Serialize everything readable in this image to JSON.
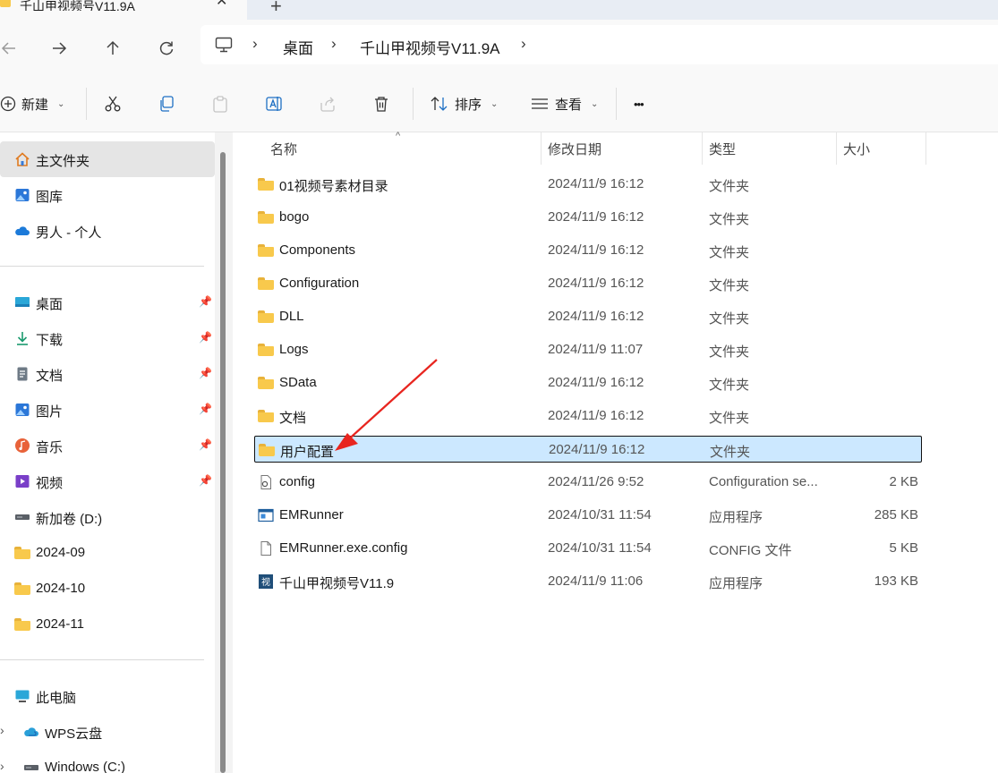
{
  "window": {
    "tab_title": "千山甲视频号V11.9A",
    "tab_close": "✕",
    "new_tab": "+"
  },
  "breadcrumb": {
    "items": [
      "桌面",
      "千山甲视频号V11.9A"
    ],
    "separator": "›"
  },
  "toolbar": {
    "new_label": "新建",
    "sort_label": "排序",
    "view_label": "查看",
    "more_label": "•••"
  },
  "sidebar": {
    "top": [
      {
        "label": "主文件夹",
        "icon": "home-icon"
      },
      {
        "label": "图库",
        "icon": "gallery-icon"
      },
      {
        "label": "男人 - 个人",
        "icon": "onedrive-cloud-icon"
      }
    ],
    "quick": [
      {
        "label": "桌面",
        "icon": "desktop-icon"
      },
      {
        "label": "下载",
        "icon": "download-icon"
      },
      {
        "label": "文档",
        "icon": "document-icon"
      },
      {
        "label": "图片",
        "icon": "pictures-icon"
      },
      {
        "label": "音乐",
        "icon": "music-icon"
      },
      {
        "label": "视频",
        "icon": "video-icon"
      },
      {
        "label": "新加卷 (D:)",
        "icon": "drive-icon"
      },
      {
        "label": "2024-09",
        "icon": "folder-icon"
      },
      {
        "label": "2024-10",
        "icon": "folder-icon"
      },
      {
        "label": "2024-11",
        "icon": "folder-icon"
      }
    ],
    "bottom": [
      {
        "label": "此电脑",
        "icon": "this-pc-icon"
      },
      {
        "label": "WPS云盘",
        "icon": "wps-cloud-icon"
      },
      {
        "label": "Windows (C:)",
        "icon": "drive-icon"
      }
    ]
  },
  "columns": {
    "name": "名称",
    "date": "修改日期",
    "type": "类型",
    "size": "大小"
  },
  "files": [
    {
      "name": "01视频号素材目录",
      "date": "2024/11/9 16:12",
      "type": "文件夹",
      "size": "",
      "icon": "folder"
    },
    {
      "name": "bogo",
      "date": "2024/11/9 16:12",
      "type": "文件夹",
      "size": "",
      "icon": "folder"
    },
    {
      "name": "Components",
      "date": "2024/11/9 16:12",
      "type": "文件夹",
      "size": "",
      "icon": "folder"
    },
    {
      "name": "Configuration",
      "date": "2024/11/9 16:12",
      "type": "文件夹",
      "size": "",
      "icon": "folder"
    },
    {
      "name": "DLL",
      "date": "2024/11/9 16:12",
      "type": "文件夹",
      "size": "",
      "icon": "folder"
    },
    {
      "name": "Logs",
      "date": "2024/11/9 11:07",
      "type": "文件夹",
      "size": "",
      "icon": "folder"
    },
    {
      "name": "SData",
      "date": "2024/11/9 16:12",
      "type": "文件夹",
      "size": "",
      "icon": "folder"
    },
    {
      "name": "文档",
      "date": "2024/11/9 16:12",
      "type": "文件夹",
      "size": "",
      "icon": "folder"
    },
    {
      "name": "用户配置",
      "date": "2024/11/9 16:12",
      "type": "文件夹",
      "size": "",
      "icon": "folder",
      "selected": true
    },
    {
      "name": "config",
      "date": "2024/11/26 9:52",
      "type": "Configuration se...",
      "size": "2 KB",
      "icon": "config-file"
    },
    {
      "name": "EMRunner",
      "date": "2024/10/31 11:54",
      "type": "应用程序",
      "size": "285 KB",
      "icon": "app-window"
    },
    {
      "name": "EMRunner.exe.config",
      "date": "2024/10/31 11:54",
      "type": "CONFIG 文件",
      "size": "5 KB",
      "icon": "blank-file"
    },
    {
      "name": "千山甲视频号V11.9",
      "date": "2024/11/9 11:06",
      "type": "应用程序",
      "size": "193 KB",
      "icon": "app-video"
    }
  ],
  "app_icon_glyph": "视",
  "colors": {
    "selection": "#cce8ff",
    "folder": "#f8c94c",
    "annotation_arrow": "#e8251f"
  }
}
